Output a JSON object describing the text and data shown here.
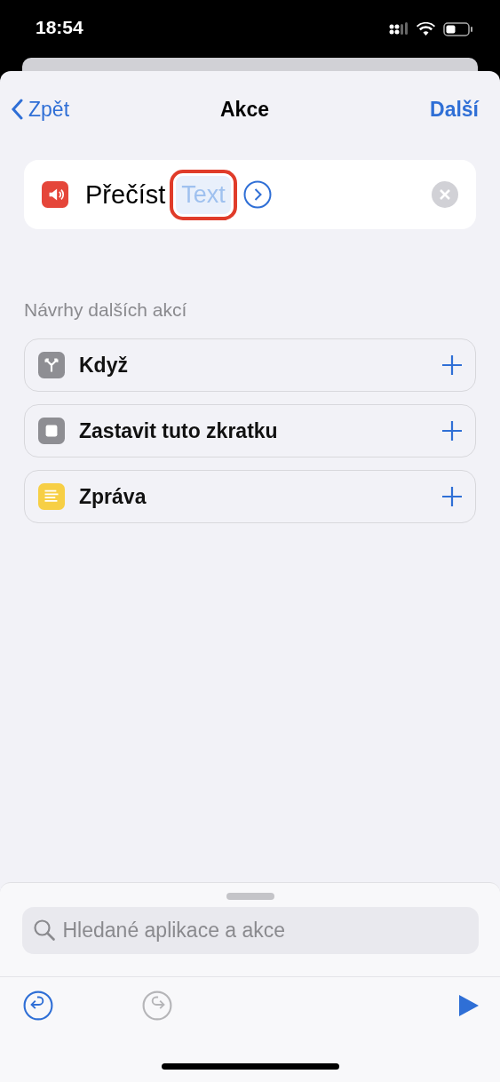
{
  "status_bar": {
    "time": "18:54"
  },
  "nav": {
    "back": "Zpět",
    "title": "Akce",
    "next": "Další"
  },
  "action": {
    "kind": "speaker",
    "verb": "Přečíst",
    "parameter": "Text",
    "highlighted": true
  },
  "suggestions": {
    "header": "Návrhy dalších akcí",
    "items": [
      {
        "kind": "branch",
        "label": "Když",
        "color": "#8e8e93"
      },
      {
        "kind": "stop",
        "label": "Zastavit tuto zkratku",
        "color": "#8e8e93"
      },
      {
        "kind": "lines",
        "label": "Zpráva",
        "color": "#f7cf45"
      }
    ]
  },
  "search": {
    "placeholder": "Hledané aplikace a akce"
  },
  "toolbar": {
    "undo": {
      "disabled": false
    },
    "redo": {
      "disabled": true
    }
  }
}
